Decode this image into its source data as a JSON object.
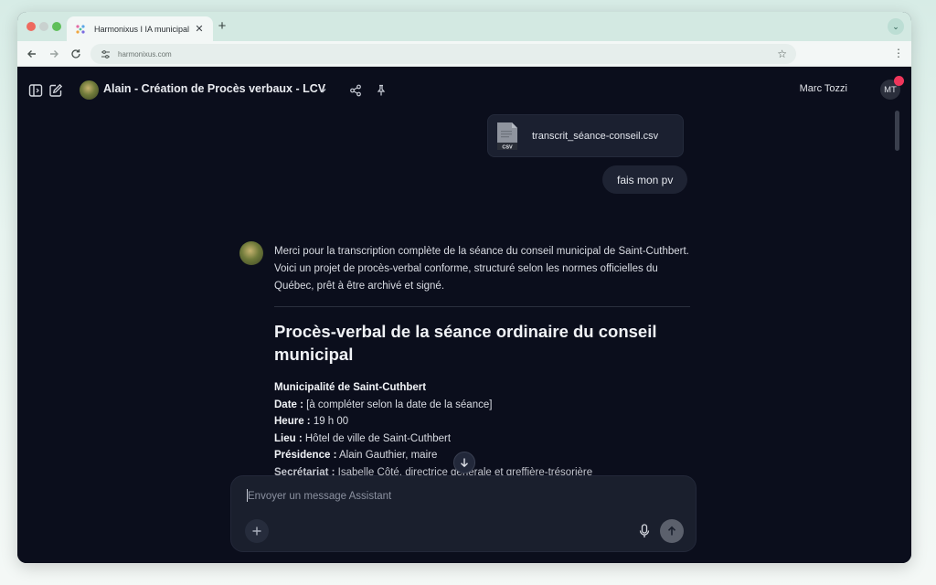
{
  "browser": {
    "tab_title": "Harmonixus I IA municipal",
    "tab_close": "✕",
    "new_tab": "+",
    "url": "harmonixus.com",
    "profile_initial": "⌄"
  },
  "app": {
    "model_name": "Alain - Création de Procès verbaux - LCV",
    "user_name": "Marc Tozzi",
    "user_initials": "MT",
    "attachment": {
      "file_name": "transcrit_séance-conseil.csv",
      "file_type": "CSV"
    },
    "user_message": "fais mon pv",
    "assistant": {
      "intro": "Merci pour la transcription complète de la séance du conseil municipal de Saint-Cuthbert. Voici un projet de procès-verbal conforme, structuré selon les normes officielles du Québec, prêt à être archivé et signé.",
      "heading": "Procès-verbal de la séance ordinaire du conseil municipal",
      "municipality": "Municipalité de Saint-Cuthbert",
      "fields": [
        {
          "label": "Date :",
          "value": " [à compléter selon la date de la séance]"
        },
        {
          "label": "Heure :",
          "value": " 19 h 00"
        },
        {
          "label": "Lieu :",
          "value": " Hôtel de ville de Saint-Cuthbert"
        },
        {
          "label": "Présidence :",
          "value": " Alain Gauthier, maire"
        }
      ],
      "cut_line_label": "Secrétariat :",
      "cut_line_value": " Isabelle Côté, directrice générale et greffière-trésorière"
    },
    "composer": {
      "placeholder": "Envoyer un message Assistant"
    }
  },
  "colors": {
    "background": "#0b0e1c",
    "accent_red": "#f0365b",
    "bubble": "#1e2333"
  }
}
